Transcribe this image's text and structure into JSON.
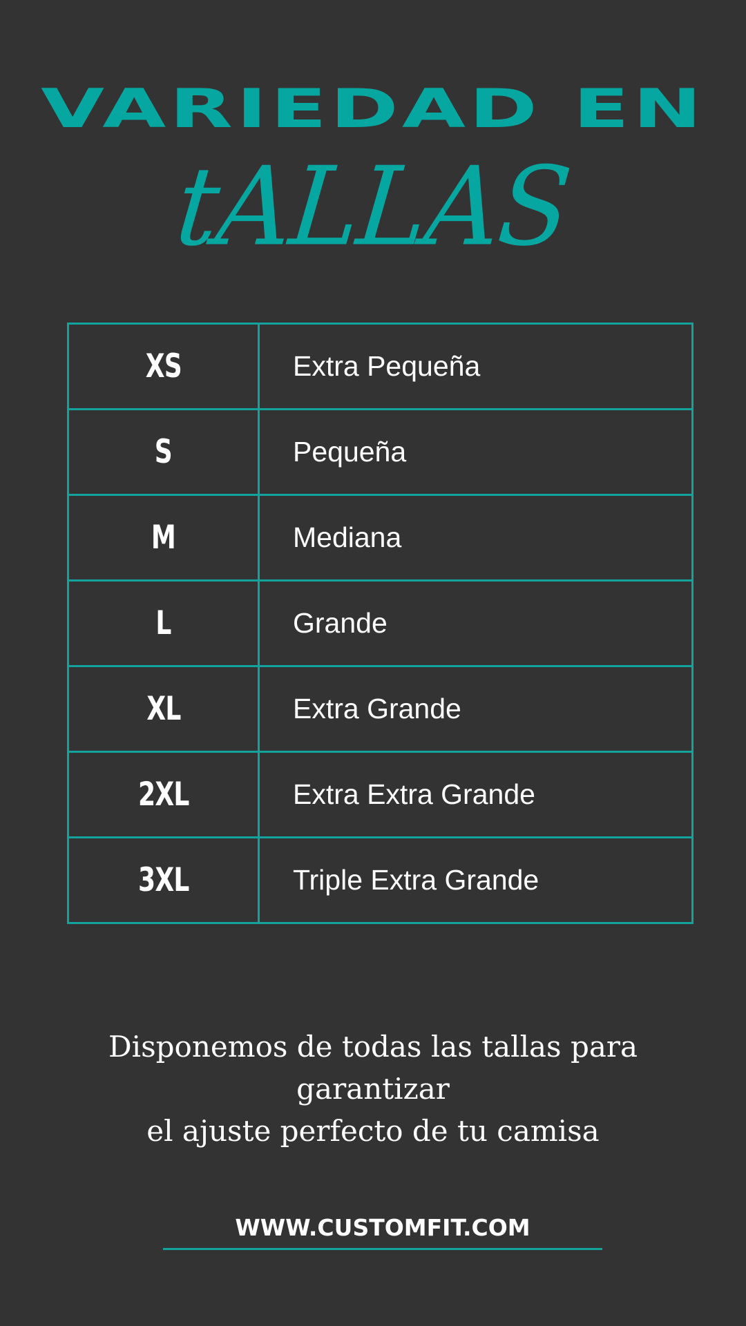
{
  "title": {
    "main": "VARIEDAD EN",
    "script": "tALLAS"
  },
  "sizes": [
    {
      "code": "XS",
      "name": "Extra Pequeña"
    },
    {
      "code": "S",
      "name": "Pequeña"
    },
    {
      "code": "M",
      "name": "Mediana"
    },
    {
      "code": "L",
      "name": "Grande"
    },
    {
      "code": "XL",
      "name": "Extra Grande"
    },
    {
      "code": "2XL",
      "name": "Extra Extra Grande"
    },
    {
      "code": "3XL",
      "name": "Triple Extra Grande"
    }
  ],
  "description": {
    "line1": "Disponemos de todas las tallas para garantizar",
    "line2": "el ajuste perfecto de tu camisa"
  },
  "website": "WWW.CUSTOMFIT.COM",
  "colors": {
    "background": "#333333",
    "accent": "#05a7a0",
    "text": "#ffffff"
  }
}
